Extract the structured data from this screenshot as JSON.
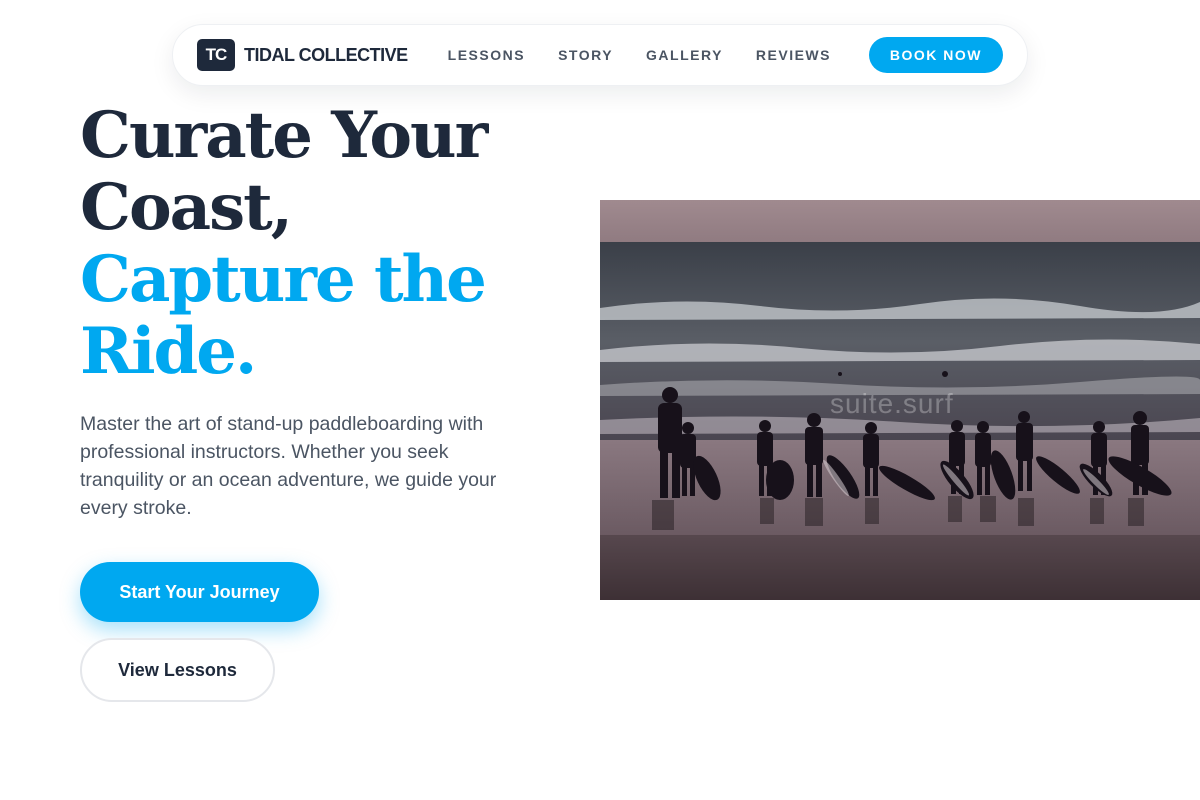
{
  "nav": {
    "logo_mark": "TC",
    "brand_name": "TIDAL COLLECTIVE",
    "links": [
      "LESSONS",
      "STORY",
      "GALLERY",
      "REVIEWS"
    ],
    "cta": "BOOK NOW"
  },
  "hero": {
    "headline_line1": "Curate Your",
    "headline_line2": "Coast,",
    "headline_line3": "Capture the",
    "headline_line4": "Ride.",
    "subtitle": "Master the art of stand-up paddleboarding with professional instructors. Whether you seek tranquility or an ocean adventure, we guide your every stroke.",
    "primary_button": "Start Your Journey",
    "secondary_button": "View Lessons"
  },
  "photo": {
    "subject": "silhouettes of surfers holding boards at the shoreline at dusk",
    "watermark": "suite.surf"
  },
  "colors": {
    "accent": "#00a8f0",
    "dark": "#1e293b",
    "text_muted": "#4b5563"
  }
}
